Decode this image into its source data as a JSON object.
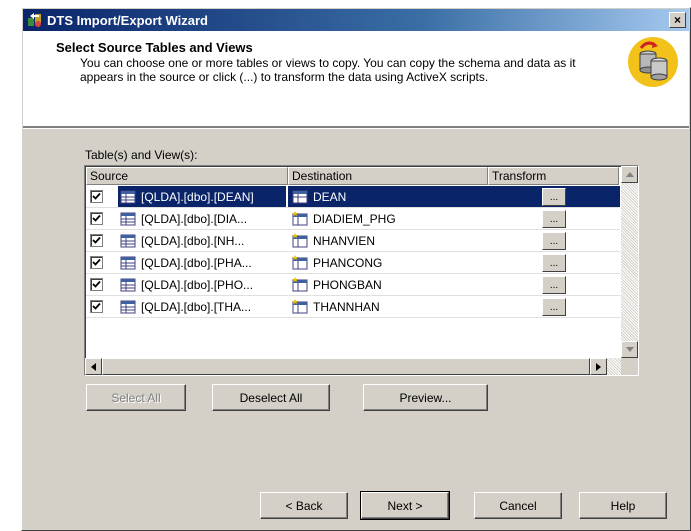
{
  "window": {
    "title": "DTS Import/Export Wizard",
    "close_label": "×"
  },
  "header": {
    "title": "Select Source Tables and Views",
    "description": "You can choose one or more tables or views to copy.  You can copy the schema and data as it appears in the source or click (...) to transform the data using ActiveX scripts."
  },
  "list": {
    "label": "Table(s) and View(s):",
    "columns": [
      "Source",
      "Destination",
      "Transform"
    ],
    "rows": [
      {
        "checked": true,
        "source": "[QLDA].[dbo].[DEAN]",
        "destination": "DEAN",
        "transform": "...",
        "selected": true
      },
      {
        "checked": true,
        "source": "[QLDA].[dbo].[DIA...",
        "destination": "DIADIEM_PHG",
        "transform": "...",
        "selected": false
      },
      {
        "checked": true,
        "source": "[QLDA].[dbo].[NH...",
        "destination": "NHANVIEN",
        "transform": "...",
        "selected": false
      },
      {
        "checked": true,
        "source": "[QLDA].[dbo].[PHA...",
        "destination": "PHANCONG",
        "transform": "...",
        "selected": false
      },
      {
        "checked": true,
        "source": "[QLDA].[dbo].[PHO...",
        "destination": "PHONGBAN",
        "transform": "...",
        "selected": false
      },
      {
        "checked": true,
        "source": "[QLDA].[dbo].[THA...",
        "destination": "THANNHAN",
        "transform": "...",
        "selected": false
      }
    ]
  },
  "actions": {
    "select_all": "Select All",
    "deselect_all": "Deselect All",
    "preview": "Preview..."
  },
  "nav": {
    "back": "< Back",
    "next": "Next >",
    "cancel": "Cancel",
    "help": "Help"
  },
  "colors": {
    "selection": "#0a246a",
    "face": "#d4d0c8"
  }
}
